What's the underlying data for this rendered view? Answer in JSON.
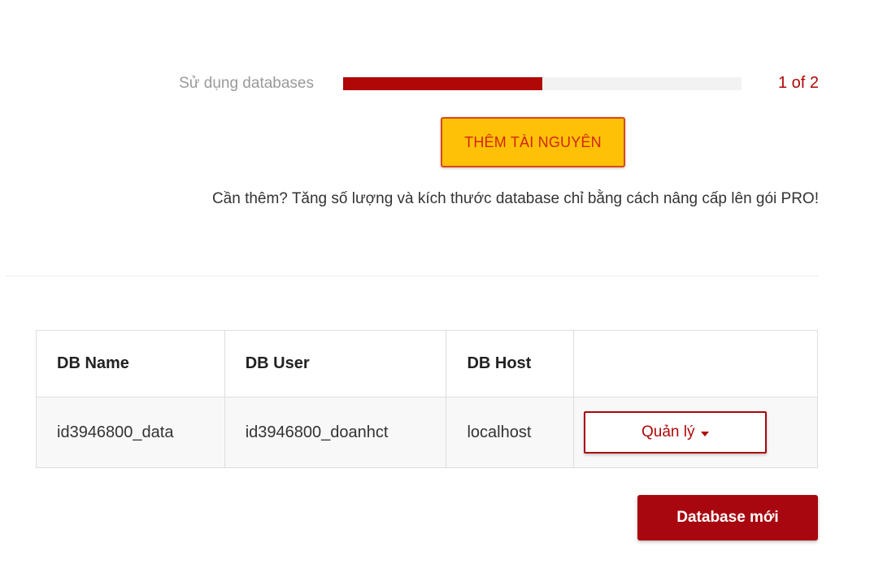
{
  "usage": {
    "label": "Sử dụng databases",
    "count_text": "1 of 2",
    "used": 1,
    "total": 2,
    "fill_fraction": 0.5,
    "fill_color": "#b00707",
    "track_color": "#f2f2f2"
  },
  "add_resource": {
    "label": "THÊM TÀI NGUYÊN"
  },
  "upgrade_note": {
    "text": "Cần thêm? Tăng số lượng và kích thước database chỉ bằng cách nâng cấp lên gói PRO!"
  },
  "table": {
    "headers": [
      "DB Name",
      "DB User",
      "DB Host",
      ""
    ],
    "rows": [
      {
        "name": "id3946800_data",
        "user": "id3946800_doanhct",
        "host": "localhost",
        "action_label": "Quản lý",
        "action_icon": "caret-down-icon"
      }
    ]
  },
  "new_database": {
    "label": "Database mới"
  },
  "colors": {
    "brand_red": "#a8070f",
    "accent_yellow": "#ffc107"
  }
}
